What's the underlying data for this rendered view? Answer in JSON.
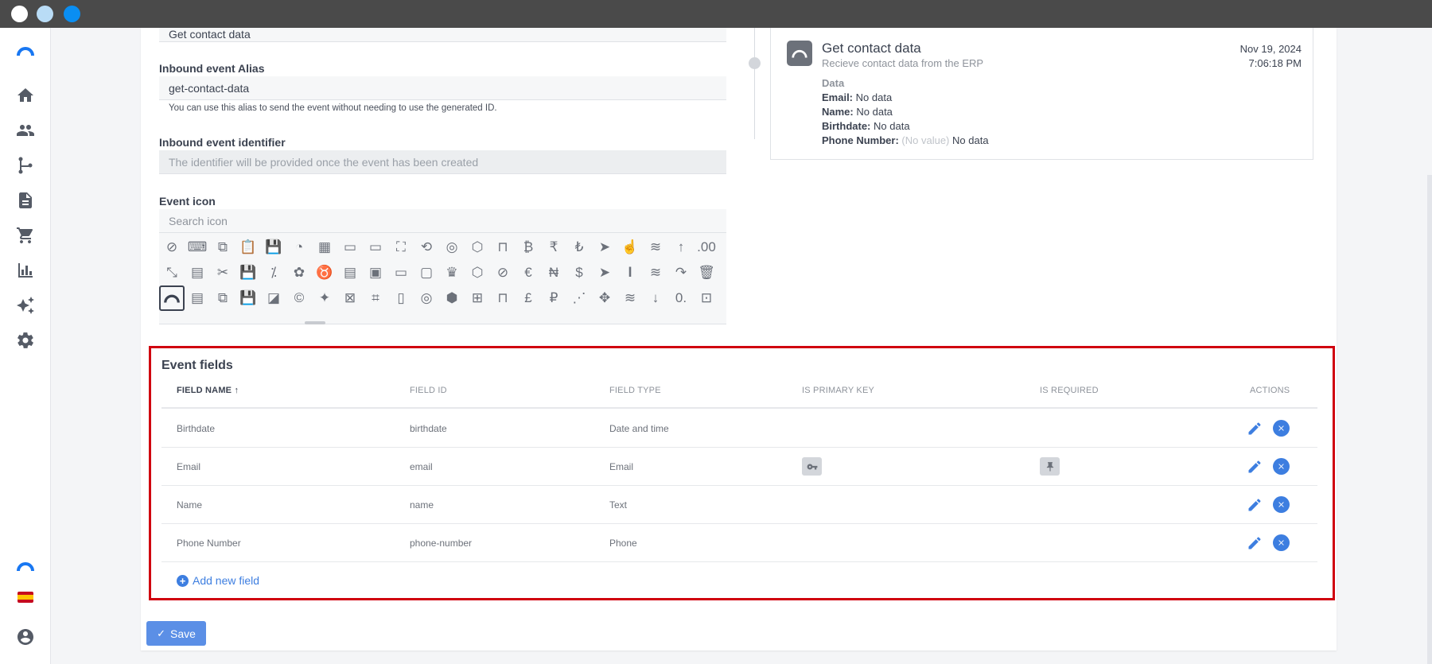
{
  "colors": {
    "accent": "#3d7ee0",
    "highlight_border": "#d0000f",
    "titlebar": "#4a4a4a"
  },
  "window": {
    "traffic_lights": [
      "#ffffff",
      "#b9dcf6",
      "#0a8ef2"
    ]
  },
  "sidebar": {
    "logo_icon": "arc-logo-icon",
    "items": [
      "home-icon",
      "people-icon",
      "flow-icon",
      "document-icon",
      "cart-icon",
      "bar-chart-icon",
      "sparkle-icon",
      "gear-icon"
    ],
    "bottom": [
      "arc-logo-icon",
      "spain-flag-icon",
      "account-circle-icon"
    ]
  },
  "form": {
    "name_value": "Get contact data",
    "alias_label": "Inbound event Alias",
    "alias_value": "get-contact-data",
    "alias_hint": "You can use this alias to send the event without needing to use the generated ID.",
    "identifier_label": "Inbound event identifier",
    "identifier_placeholder": "The identifier will be provided once the event has been created",
    "icon_label": "Event icon",
    "icon_search_placeholder": "Search icon",
    "icon_grid": [
      [
        "⊘",
        "⌨",
        "⧉",
        "📋",
        "💾",
        "◔",
        "▦",
        "▭",
        "▭",
        "⛶",
        "⟲",
        "◎",
        "⬡",
        "⊓",
        "₿",
        "₹",
        "₺",
        "➤",
        "☝",
        "≋",
        "↑",
        ".00"
      ],
      [
        "⤡",
        "▤",
        "✂",
        "💾",
        "⁒",
        "✿",
        "♉",
        "▤",
        "▣",
        "▭",
        "▢",
        "♛",
        "⬡",
        "⊘",
        "€",
        "₦",
        "$",
        "➤",
        "𝐈",
        "≋",
        "↷",
        "🗑"
      ],
      [
        "◠",
        "▤",
        "⧉",
        "💾",
        "◪",
        "©",
        "✦",
        "⊠",
        "⌗",
        "▯",
        "◎",
        "⬢",
        "⊞",
        "⊓",
        "£",
        "₽",
        "⋰",
        "✥",
        "≋",
        "↓",
        "0.",
        "⊡"
      ]
    ],
    "selected_icon": "arc-icon"
  },
  "event_card": {
    "title": "Get contact data",
    "subtitle": "Recieve contact data from the ERP",
    "date": "Nov 19, 2024",
    "time": "7:06:18 PM",
    "data_header": "Data",
    "rows": [
      {
        "key": "Email:",
        "noval": "",
        "value": "No data"
      },
      {
        "key": "Name:",
        "noval": "",
        "value": "No data"
      },
      {
        "key": "Birthdate:",
        "noval": "",
        "value": "No data"
      },
      {
        "key": "Phone Number:",
        "noval": "(No value)",
        "value": "No data"
      }
    ]
  },
  "event_fields": {
    "title": "Event fields",
    "columns": [
      "FIELD NAME",
      "FIELD ID",
      "FIELD TYPE",
      "IS PRIMARY KEY",
      "IS REQUIRED",
      "ACTIONS"
    ],
    "sort_indicator": "↑",
    "rows": [
      {
        "name": "Birthdate",
        "id": "birthdate",
        "type": "Date and time",
        "primary_key": false,
        "required": false
      },
      {
        "name": "Email",
        "id": "email",
        "type": "Email",
        "primary_key": true,
        "required": true
      },
      {
        "name": "Name",
        "id": "name",
        "type": "Text",
        "primary_key": false,
        "required": false
      },
      {
        "name": "Phone Number",
        "id": "phone-number",
        "type": "Phone",
        "primary_key": false,
        "required": false
      }
    ],
    "add_label": "Add new field"
  },
  "actions": {
    "save_label": "Save"
  }
}
